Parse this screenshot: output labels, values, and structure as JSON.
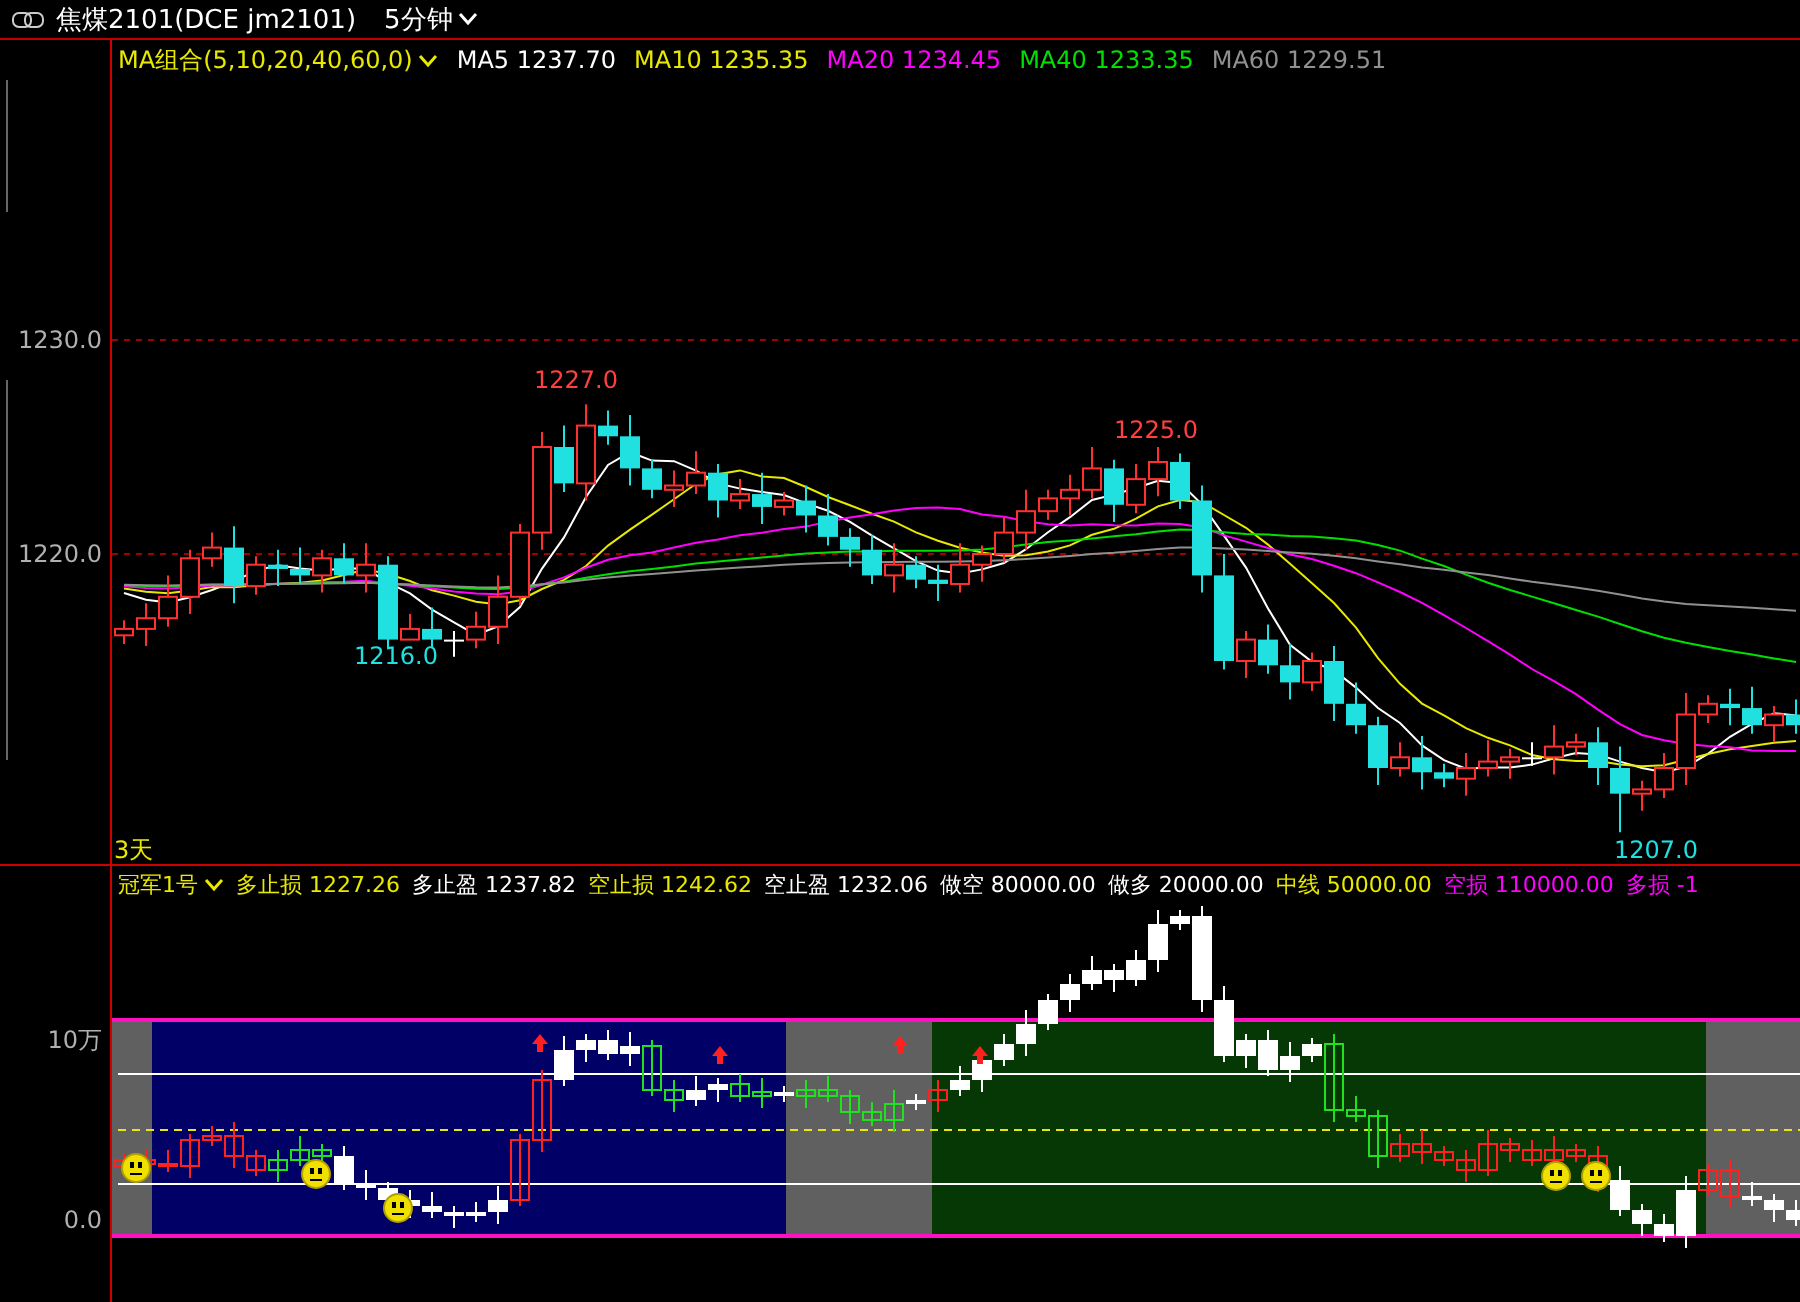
{
  "header": {
    "title": "焦煤2101(DCE jm2101)",
    "period": "5分钟"
  },
  "ma_legend": {
    "label": "MA组合(5,10,20,40,60,0)",
    "items": [
      {
        "name": "MA5",
        "value": "1237.70",
        "color": "#ffffff"
      },
      {
        "name": "MA10",
        "value": "1235.35",
        "color": "#e8e800"
      },
      {
        "name": "MA20",
        "value": "1234.45",
        "color": "#ff00ff"
      },
      {
        "name": "MA40",
        "value": "1233.35",
        "color": "#00e000"
      },
      {
        "name": "MA60",
        "value": "1229.51",
        "color": "#909090"
      }
    ]
  },
  "price_chart": {
    "y_labels": [
      "1230.0",
      "1220.0"
    ],
    "markers": [
      {
        "text": "1227.0",
        "kind": "high"
      },
      {
        "text": "1216.0",
        "kind": "low"
      },
      {
        "text": "1225.0",
        "kind": "high"
      },
      {
        "text": "1207.0",
        "kind": "low"
      }
    ],
    "range_label": "3天"
  },
  "indicator_legend": {
    "name": "冠军1号",
    "items": [
      {
        "name": "多止损",
        "value": "1227.26",
        "color": "#e8e800"
      },
      {
        "name": "多止盈",
        "value": "1237.82",
        "color": "#ffffff"
      },
      {
        "name": "空止损",
        "value": "1242.62",
        "color": "#e8e800"
      },
      {
        "name": "空止盈",
        "value": "1232.06",
        "color": "#ffffff"
      },
      {
        "name": "做空",
        "value": "80000.00",
        "color": "#ffffff"
      },
      {
        "name": "做多",
        "value": "20000.00",
        "color": "#ffffff"
      },
      {
        "name": "中线",
        "value": "50000.00",
        "color": "#e8e800"
      },
      {
        "name": "空损",
        "value": "110000.00",
        "color": "#ff00ff"
      },
      {
        "name": "多损",
        "value": "-1",
        "color": "#ff00ff"
      }
    ]
  },
  "indicator_chart": {
    "y_labels": [
      "10万",
      "0.0"
    ]
  }
}
